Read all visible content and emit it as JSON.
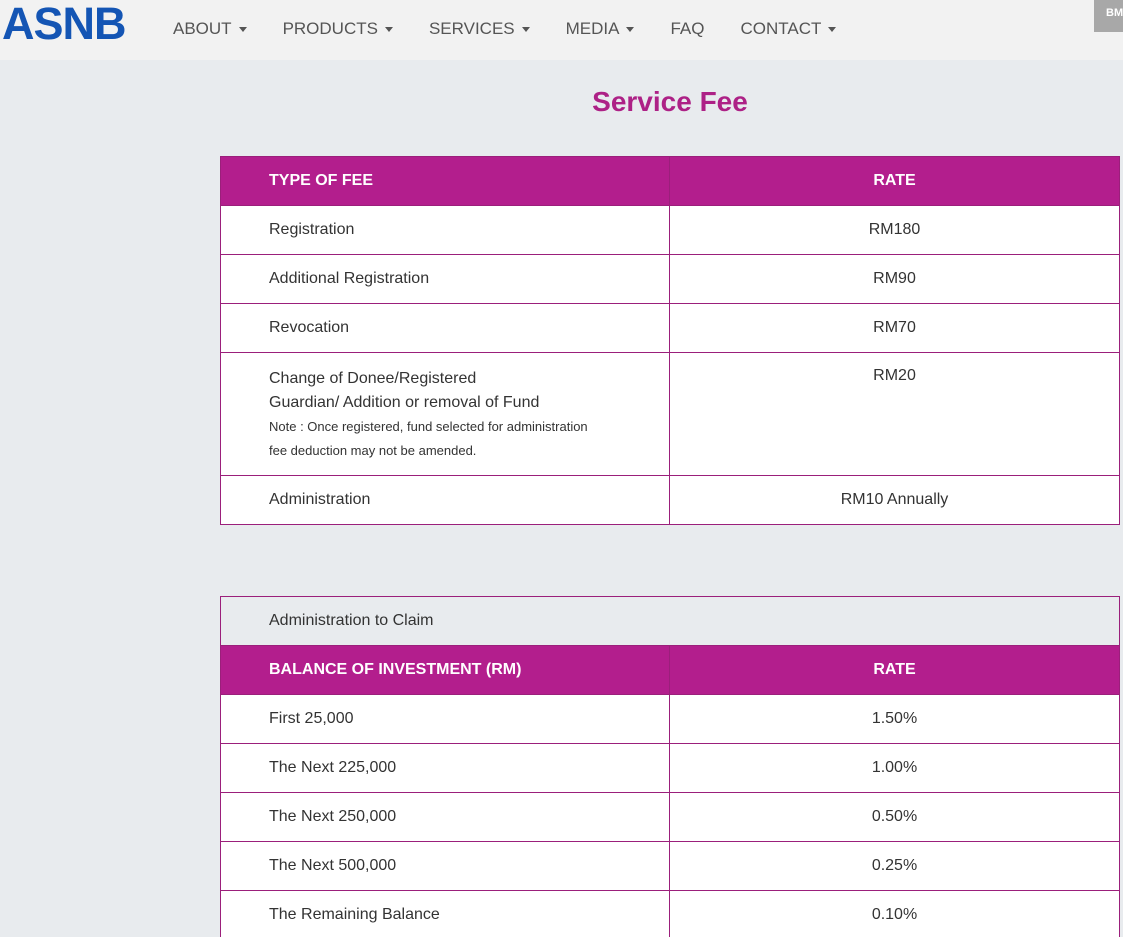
{
  "header": {
    "logo": "ASNB",
    "nav": [
      {
        "label": "ABOUT",
        "dropdown": true
      },
      {
        "label": "PRODUCTS",
        "dropdown": true
      },
      {
        "label": "SERVICES",
        "dropdown": true
      },
      {
        "label": "MEDIA",
        "dropdown": true
      },
      {
        "label": "FAQ",
        "dropdown": false
      },
      {
        "label": "CONTACT",
        "dropdown": true
      }
    ],
    "lang_button": "BM"
  },
  "page": {
    "title": "Service Fee"
  },
  "fee_table": {
    "headers": [
      "TYPE OF FEE",
      "RATE"
    ],
    "rows": [
      {
        "fee": "Registration",
        "rate": "RM180"
      },
      {
        "fee": "Additional Registration",
        "rate": "RM90"
      },
      {
        "fee": "Revocation",
        "rate": "RM70"
      },
      {
        "fee_line1": "Change of Donee/Registered",
        "fee_line2": "Guardian/ Addition or removal of Fund",
        "note_line1": "Note : Once registered, fund selected for administration",
        "note_line2": "fee deduction may not be amended.",
        "rate": "RM20"
      },
      {
        "fee": "Administration",
        "rate": "RM10 Annually"
      }
    ]
  },
  "claim_table": {
    "caption": "Administration to Claim",
    "headers": [
      "BALANCE OF INVESTMENT (RM)",
      "RATE"
    ],
    "rows": [
      {
        "balance": "First 25,000",
        "rate": "1.50%"
      },
      {
        "balance": "The Next 225,000",
        "rate": "1.00%"
      },
      {
        "balance": "The Next 250,000",
        "rate": "0.50%"
      },
      {
        "balance": "The Next 500,000",
        "rate": "0.25%"
      },
      {
        "balance": "The Remaining Balance",
        "rate": "0.10%"
      }
    ]
  },
  "colors": {
    "brand_blue": "#1455b4",
    "accent_magenta": "#b31e8d",
    "title_magenta": "#ad2186"
  }
}
